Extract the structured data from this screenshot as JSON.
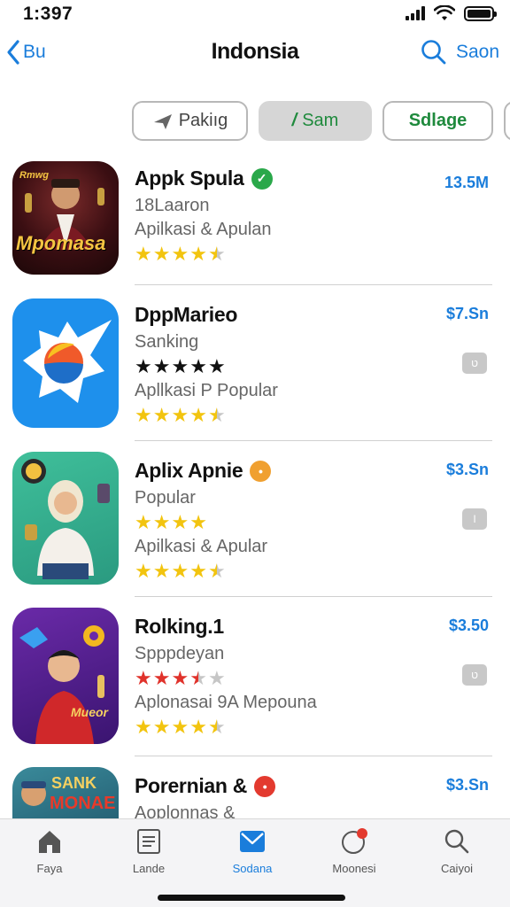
{
  "status": {
    "time": "1:397"
  },
  "nav": {
    "back_label": "Bu",
    "title": "Indonsia",
    "search_label": "Saon"
  },
  "chips": [
    {
      "label": "Pakiıg"
    },
    {
      "label": "Sam"
    },
    {
      "label": "Sdlage"
    }
  ],
  "apps": [
    {
      "name": "Appk Spula",
      "badge_color": "#2aa84a",
      "badge_text": "✓",
      "price": "13.5M",
      "lines": [
        "18Laaron",
        "Apilkasi & Apulan"
      ],
      "ratings": [
        4.5
      ],
      "button_text": "",
      "icon_text_top": "Rmwg",
      "icon_text_main": "Mpomasa"
    },
    {
      "name": "DppMarieo",
      "badge_color": "",
      "badge_text": "",
      "price": "$7.Sn",
      "lines": [
        "Sanking",
        "Apllkasi P Popular"
      ],
      "ratings": [
        5,
        4.5
      ],
      "button_text": "ט",
      "icon_text_top": "",
      "icon_text_main": ""
    },
    {
      "name": "Aplix Apnie",
      "badge_color": "#f0a030",
      "badge_text": "•",
      "price": "$3.Sn",
      "lines": [
        "Popular",
        "Apilkasi & Apular"
      ],
      "ratings": [
        4,
        4.5
      ],
      "button_text": "I",
      "icon_text_top": "",
      "icon_text_main": ""
    },
    {
      "name": "Rolking.1",
      "badge_color": "",
      "badge_text": "",
      "price": "$3.50",
      "lines": [
        "Spppdeyan",
        "Aplonasai 9A Mepouna"
      ],
      "ratings": [
        3.5,
        4.5
      ],
      "button_text": "ט",
      "icon_text_top": "",
      "icon_text_main": "Mueor"
    },
    {
      "name": "Porernian &",
      "badge_color": "#e33a2f",
      "badge_text": "•",
      "price": "$3.Sn",
      "lines": [
        "Aoplonnas &"
      ],
      "ratings": [],
      "button_text": "",
      "icon_text_top": "SANK",
      "icon_text_main": "MONAE"
    }
  ],
  "tabs": [
    {
      "label": "Faya",
      "icon": "home-icon"
    },
    {
      "label": "Lande",
      "icon": "document-icon"
    },
    {
      "label": "Sodana",
      "icon": "mail-icon"
    },
    {
      "label": "Moonesi",
      "icon": "notification-icon"
    },
    {
      "label": "Caiyoi",
      "icon": "search-icon"
    }
  ],
  "colors": {
    "accent": "#1a7ddb",
    "star_gold": "#f2c40f",
    "star_black": "#111111",
    "star_red": "#e0322b",
    "star_empty": "#c6c6c6"
  }
}
